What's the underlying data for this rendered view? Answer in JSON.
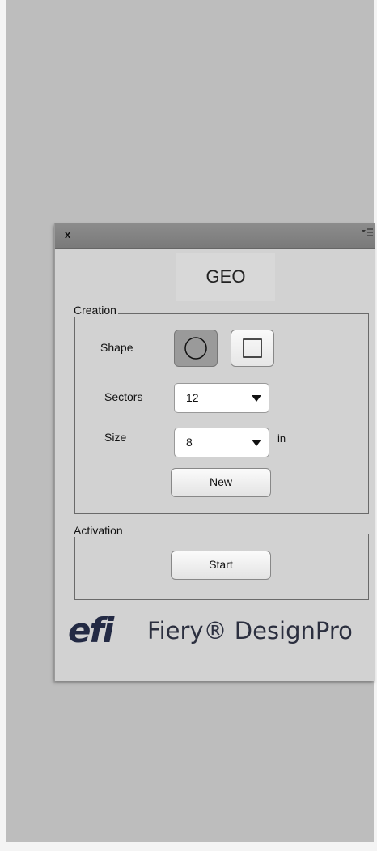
{
  "panel": {
    "close_label": "x",
    "title": "GEO",
    "creation": {
      "legend": "Creation",
      "shape_label": "Shape",
      "shape_options": [
        {
          "name": "circle",
          "selected": true
        },
        {
          "name": "square",
          "selected": false
        }
      ],
      "sectors_label": "Sectors",
      "sectors_value": "12",
      "size_label": "Size",
      "size_value": "8",
      "size_unit": "in",
      "new_button": "New"
    },
    "activation": {
      "legend": "Activation",
      "start_button": "Start"
    },
    "logo": {
      "mark": "efi",
      "product": "Fiery® DesignPro"
    }
  },
  "icons": {
    "menu": "panel-menu-icon",
    "dropdown": "triangle-down-icon",
    "circle": "circle-shape-icon",
    "square": "square-shape-icon"
  },
  "colors": {
    "background": "#bdbdbd",
    "panel": "#d2d2d2",
    "titlebar": "#808080",
    "selected_button": "#9a9a9a",
    "logo": "#232a44"
  }
}
